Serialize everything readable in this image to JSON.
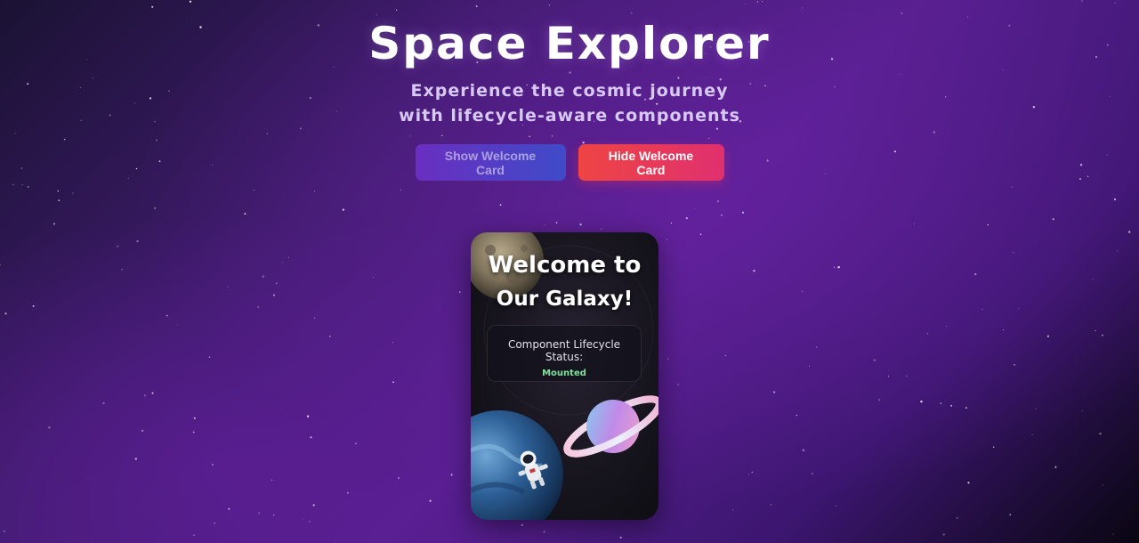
{
  "header": {
    "title": "Space Explorer",
    "subtitle_line1": "Experience the cosmic journey",
    "subtitle_line2": "with lifecycle-aware components"
  },
  "buttons": {
    "show_label": "Show Welcome Card",
    "hide_label": "Hide Welcome Card",
    "show_disabled": true
  },
  "card": {
    "title_line1": "Welcome to",
    "title_line2": "Our Galaxy!",
    "status_label": "Component Lifecycle Status:",
    "status_value": "Mounted",
    "illustration_icons": [
      "moon-planet-icon",
      "ringed-planet-icon",
      "earth-planet-icon",
      "astronaut-icon"
    ]
  },
  "colors": {
    "show_button": "#5a3cc4",
    "hide_button": "#e83c5a",
    "status_mounted": "#7ee39a",
    "background_accent": "#561f8e"
  }
}
